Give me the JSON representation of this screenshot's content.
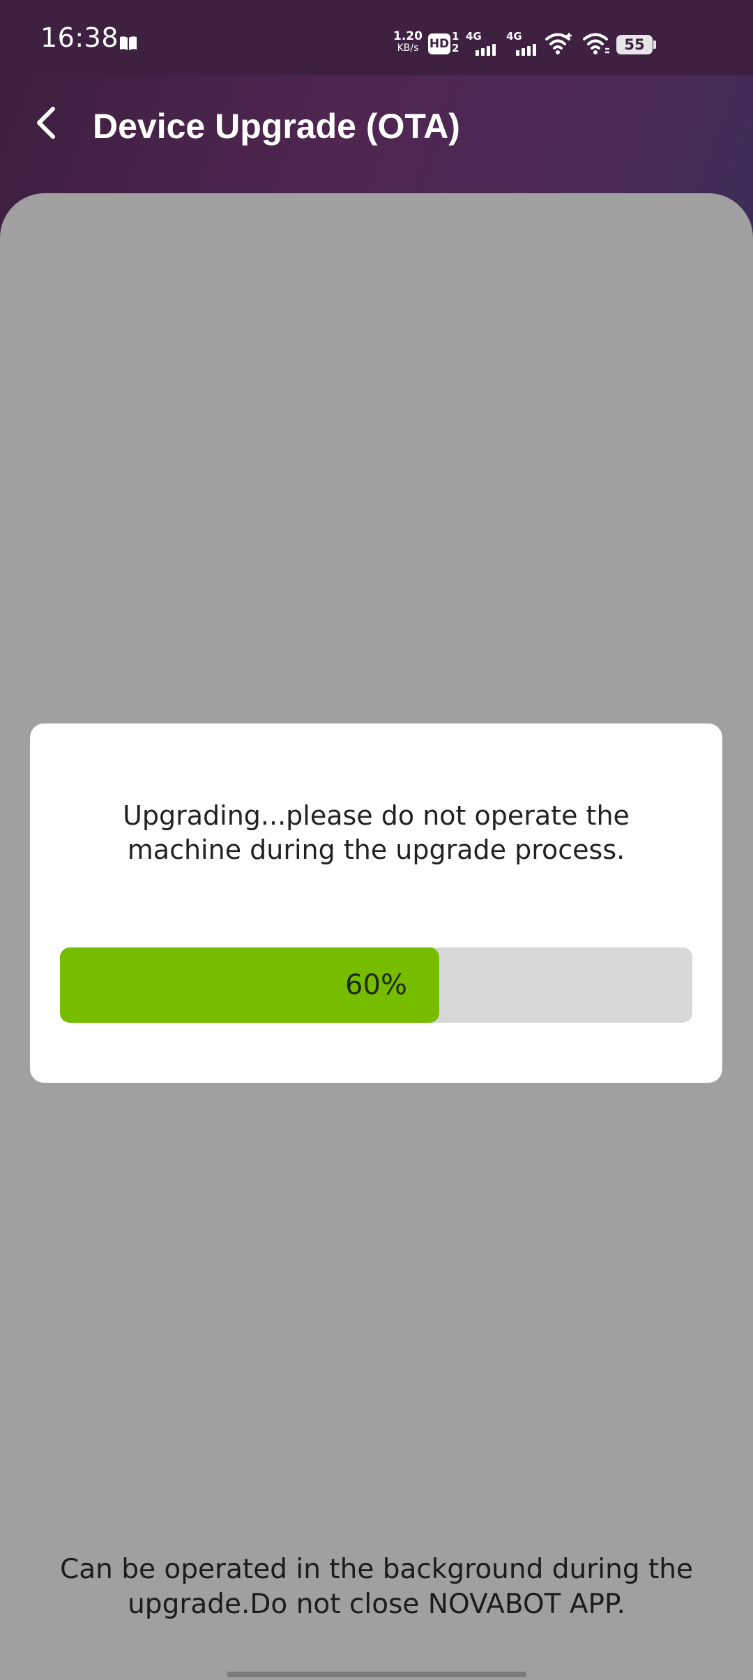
{
  "status_bar": {
    "time": "16:38",
    "net_speed_value": "1.20",
    "net_speed_unit": "KB/s",
    "hd_label": "HD",
    "hd_sim_top": "1",
    "hd_sim_bottom": "2",
    "signal_1_label": "4G",
    "signal_2_label": "4G",
    "battery_level": "55"
  },
  "header": {
    "title": "Device Upgrade (OTA)"
  },
  "dialog": {
    "message_line_1": "Upgrading...please do not operate the",
    "message_line_2": "machine during the upgrade process.",
    "progress_label": "60%",
    "progress_fraction": 0.6,
    "progress_color": "#76bd00"
  },
  "footer": {
    "note_line_1": "Can be operated in the background during the",
    "note_line_2": "upgrade.Do not close NOVABOT APP."
  },
  "icons": {
    "back": "chevron-left-icon",
    "notification": "book-icon",
    "wifi": "wifi-icon"
  }
}
